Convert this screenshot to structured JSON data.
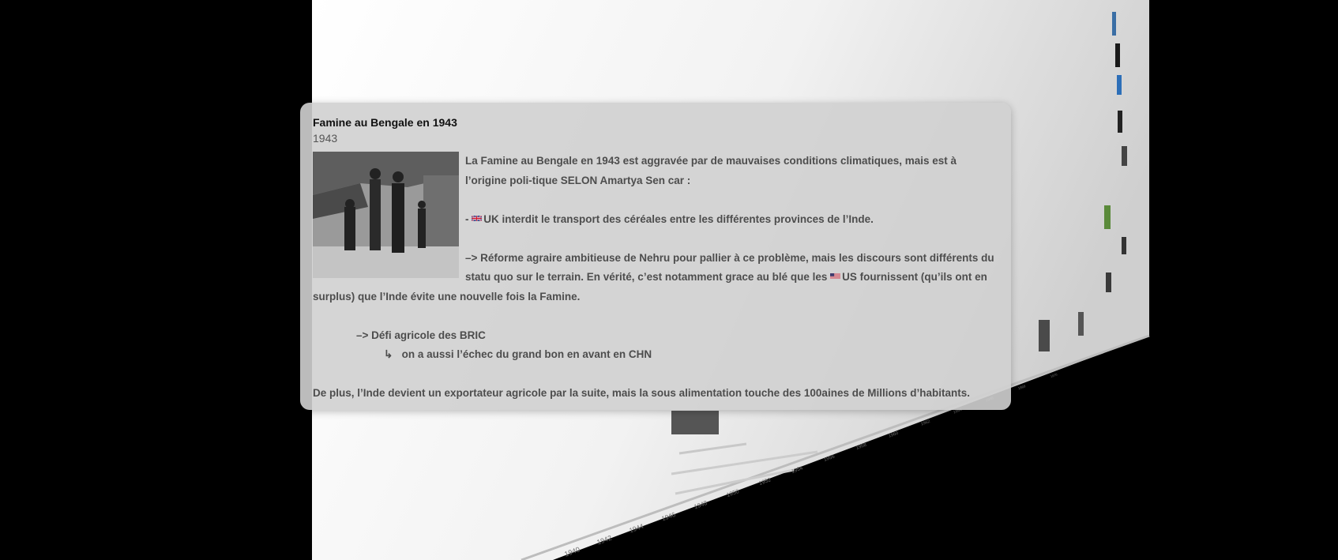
{
  "event": {
    "title": "Famine au Bengale en 1943",
    "year": "1943",
    "image_alt_icon": "photo-famine-family",
    "paragraphs": {
      "p1": "La Famine au Bengale en 1943 est aggravée par de mauvaises conditions climatiques, mais est à l’origine poli-tique SELON Amartya Sen car :",
      "p2_prefix": "- ",
      "p2_flag": "uk-flag-icon",
      "p2_text": "UK  interdit le transport des céréales entre les différentes provinces de l’Inde.",
      "p3_part1": " –> Réforme agraire ambitieuse de Nehru pour pallier à ce problème, mais les discours sont différents du statu quo sur le terrain. En vérité, c’est notamment grace au blé que les ",
      "p3_flag": "us-flag-icon",
      "p3_part2": "US fournissent (qu’ils ont en surplus) que l’Inde évite une nouvelle fois la Famine.",
      "p4": "–> Défi agricole des BRIC",
      "p5_arrow": "↳",
      "p5_text": "on a aussi l’échec du grand bon en avant en CHN",
      "p6": "De plus, l’Inde devient un exportateur agricole par la suite, mais la sous alimentation touche des 100aines de Millions d’habitants."
    }
  },
  "timeline": {
    "axis_years": [
      "1940",
      "1942",
      "1944",
      "1946",
      "1948",
      "1950",
      "1952",
      "1954",
      "1956",
      "1958",
      "1960",
      "1962",
      "1964",
      "1966",
      "1968",
      "1970"
    ]
  },
  "colors": {
    "background": "#000000",
    "plane_light": "#ffffff",
    "plane_dark": "#d9d9d9",
    "card_bg": "rgba(208,208,208,0.90)",
    "uk_flag_red": "#cf142b",
    "uk_flag_blue": "#00247d",
    "us_flag_red": "#b22234",
    "us_flag_blue": "#3c3b6e"
  }
}
